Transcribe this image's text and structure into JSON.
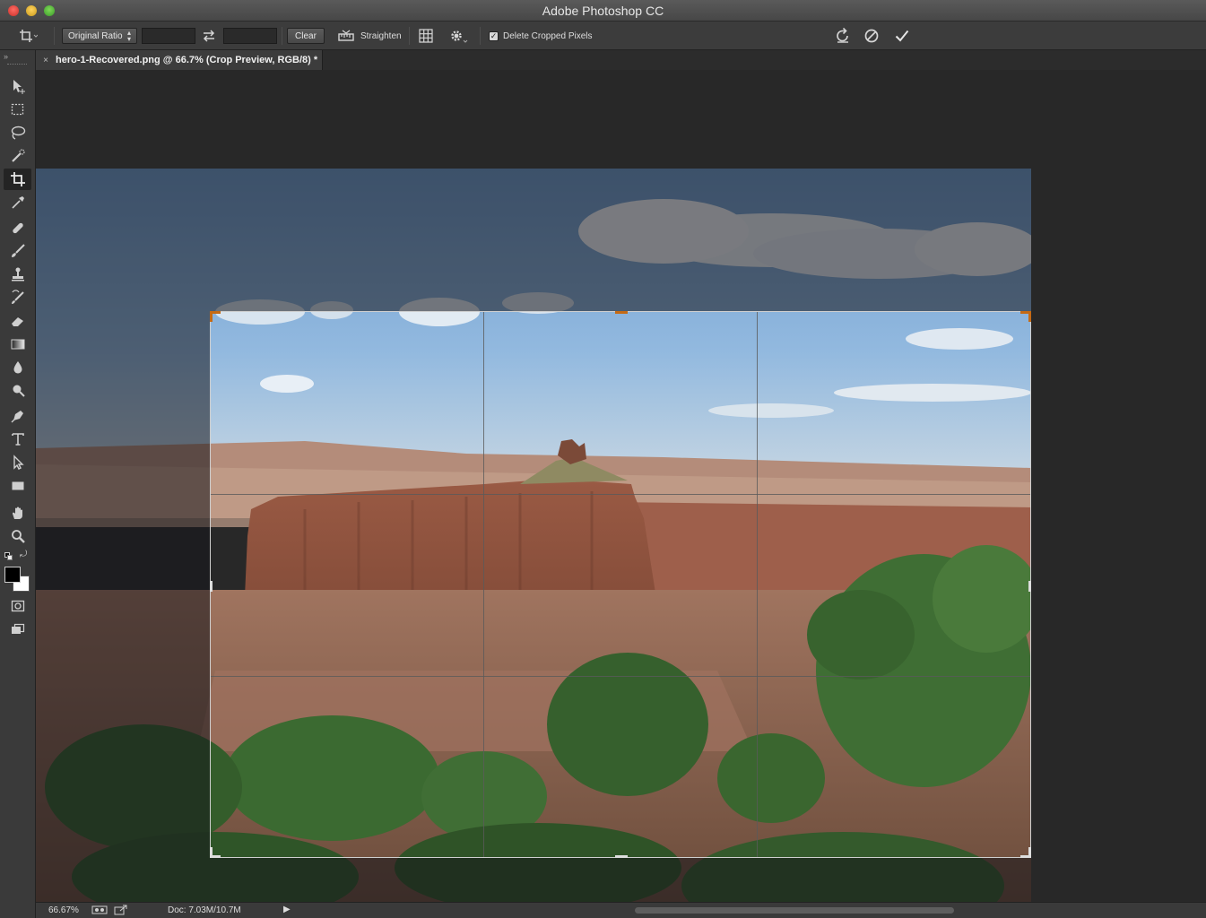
{
  "window": {
    "title": "Adobe Photoshop CC"
  },
  "options_bar": {
    "ratio_select": "Original Ratio",
    "clear_label": "Clear",
    "straighten_label": "Straighten",
    "delete_cropped_label": "Delete Cropped Pixels",
    "delete_cropped_checked": true,
    "icons": [
      "crop-tool-icon",
      "swap-icon",
      "straighten-icon",
      "overlay-grid-icon",
      "gear-icon",
      "reset-icon",
      "cancel-icon",
      "commit-check-icon"
    ]
  },
  "document_tab": {
    "close_glyph": "×",
    "title": "hero-1-Recovered.png @ 66.7% (Crop Preview, RGB/8) *"
  },
  "tools": [
    "move-tool-icon",
    "marquee-tool-icon",
    "lasso-tool-icon",
    "quick-selection-tool-icon",
    "crop-tool-icon",
    "eyedropper-tool-icon",
    "healing-brush-tool-icon",
    "brush-tool-icon",
    "clone-stamp-tool-icon",
    "history-brush-tool-icon",
    "eraser-tool-icon",
    "gradient-tool-icon",
    "blur-tool-icon",
    "dodge-tool-icon",
    "pen-tool-icon",
    "type-tool-icon",
    "path-selection-tool-icon",
    "rectangle-tool-icon",
    "hand-tool-icon",
    "zoom-tool-icon"
  ],
  "colors": {
    "foreground": "#000000",
    "background": "#ffffff",
    "crop_handle": "#c56a14"
  },
  "status_bar": {
    "zoom": "66.67%",
    "doc": "Doc: 7.03M/10.7M"
  }
}
